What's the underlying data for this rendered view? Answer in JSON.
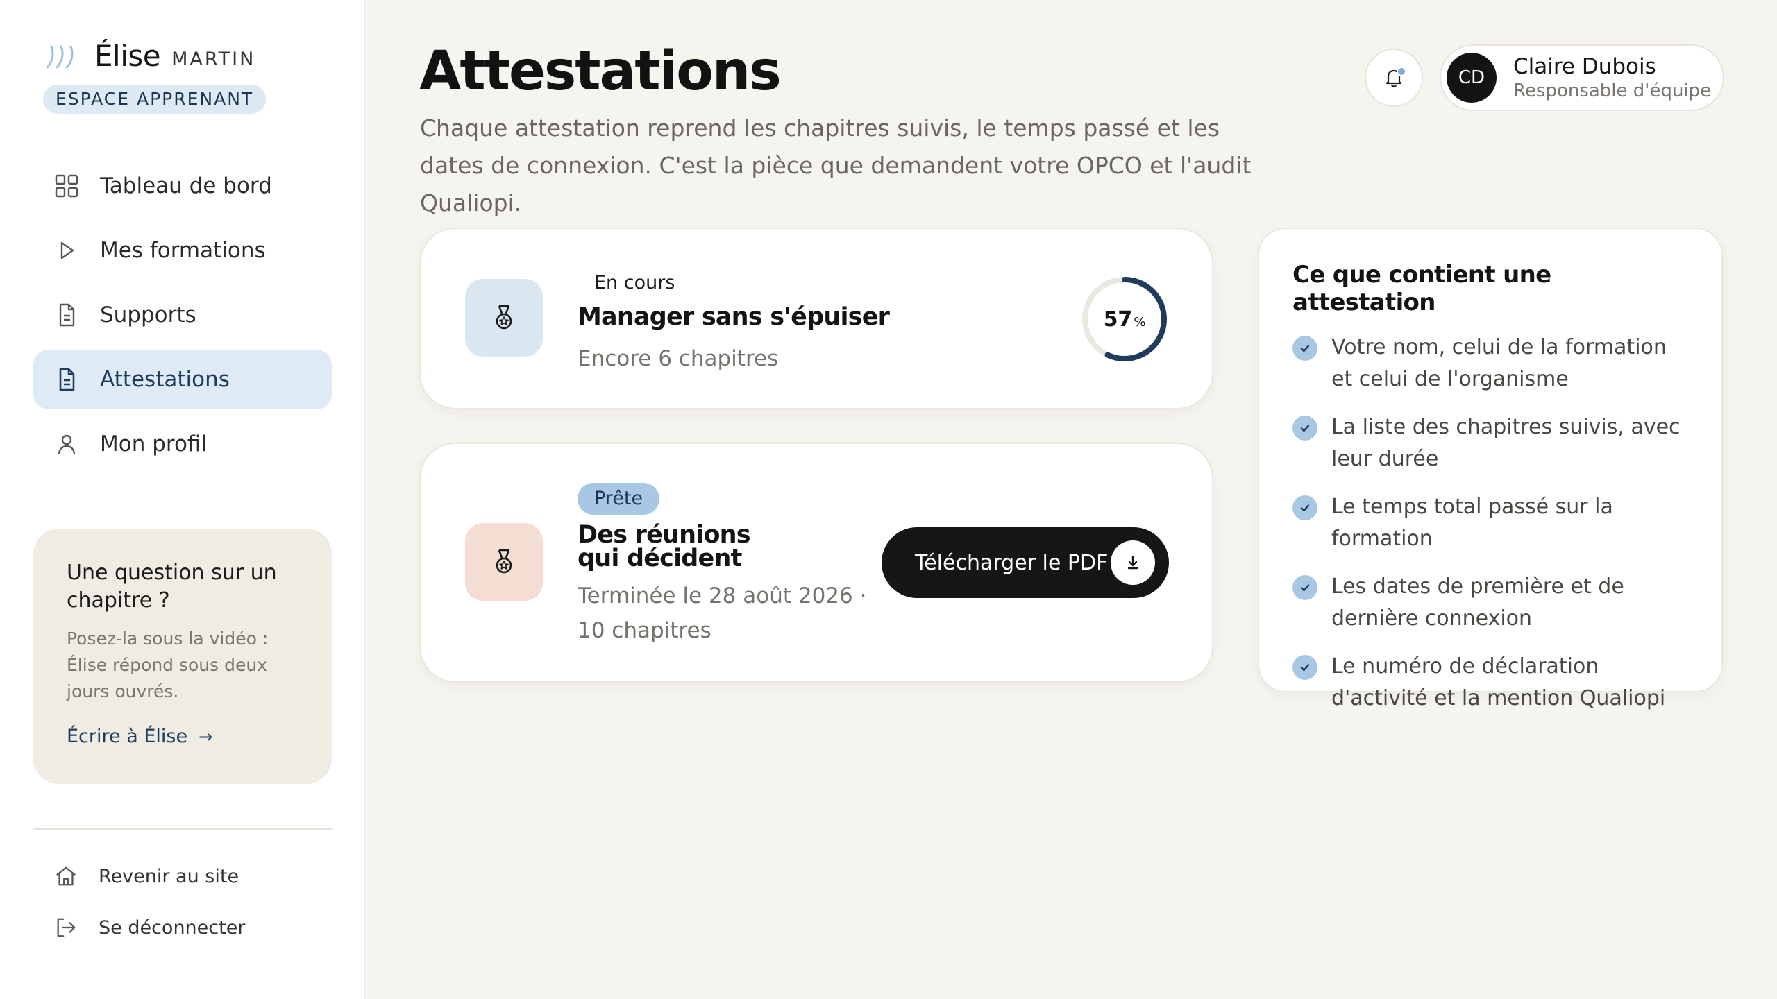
{
  "brand": {
    "first": "Élise",
    "last": "MARTIN",
    "badge": "ESPACE APPRENANT"
  },
  "nav": {
    "items": [
      {
        "label": "Tableau de bord",
        "icon": "dashboard-grid-icon"
      },
      {
        "label": "Mes formations",
        "icon": "play-icon"
      },
      {
        "label": "Supports",
        "icon": "document-icon"
      },
      {
        "label": "Attestations",
        "icon": "document-icon",
        "active": true
      },
      {
        "label": "Mon profil",
        "icon": "user-icon"
      }
    ]
  },
  "help": {
    "title": "Une question sur un chapitre ?",
    "text": "Posez-la sous la vidéo : Élise répond sous deux jours ouvrés.",
    "link": "Écrire à Élise",
    "arrow": "→"
  },
  "footer_nav": {
    "items": [
      {
        "label": "Revenir au site",
        "icon": "home-icon"
      },
      {
        "label": "Se déconnecter",
        "icon": "logout-icon"
      }
    ]
  },
  "header": {
    "title": "Attestations",
    "subtitle": "Chaque attestation reprend les chapitres suivis, le temps passé et les dates de connexion. C'est la pièce que demandent votre OPCO et l'audit Qualiopi."
  },
  "user": {
    "initials": "CD",
    "name": "Claire Dubois",
    "role": "Responsable d'équipe",
    "has_notification": true
  },
  "attestations": [
    {
      "status": "En cours",
      "title": "Manager sans s'épuiser",
      "meta": "Encore 6 chapitres",
      "progress": 57,
      "progress_unit": "%"
    },
    {
      "status": "Prête",
      "title": "Des réunions qui décident",
      "meta": "Terminée le 28 août 2026 · 10 chapitres",
      "action": "Télécharger le PDF"
    }
  ],
  "info": {
    "title": "Ce que contient une attestation",
    "items": [
      "Votre nom, celui de la formation et celui de l'organisme",
      "La liste des chapitres suivis, avec leur durée",
      "Le temps total passé sur la formation",
      "Les dates de première et de dernière connexion",
      "Le numéro de déclaration d'activité et la mention Qualiopi"
    ]
  },
  "colors": {
    "accent": "#1f3c5b",
    "accent_light": "#deebf6",
    "badge_blue": "#a8c7e5",
    "peach": "#f4ddd2",
    "background": "#f6f4ee",
    "dark": "#161616"
  }
}
